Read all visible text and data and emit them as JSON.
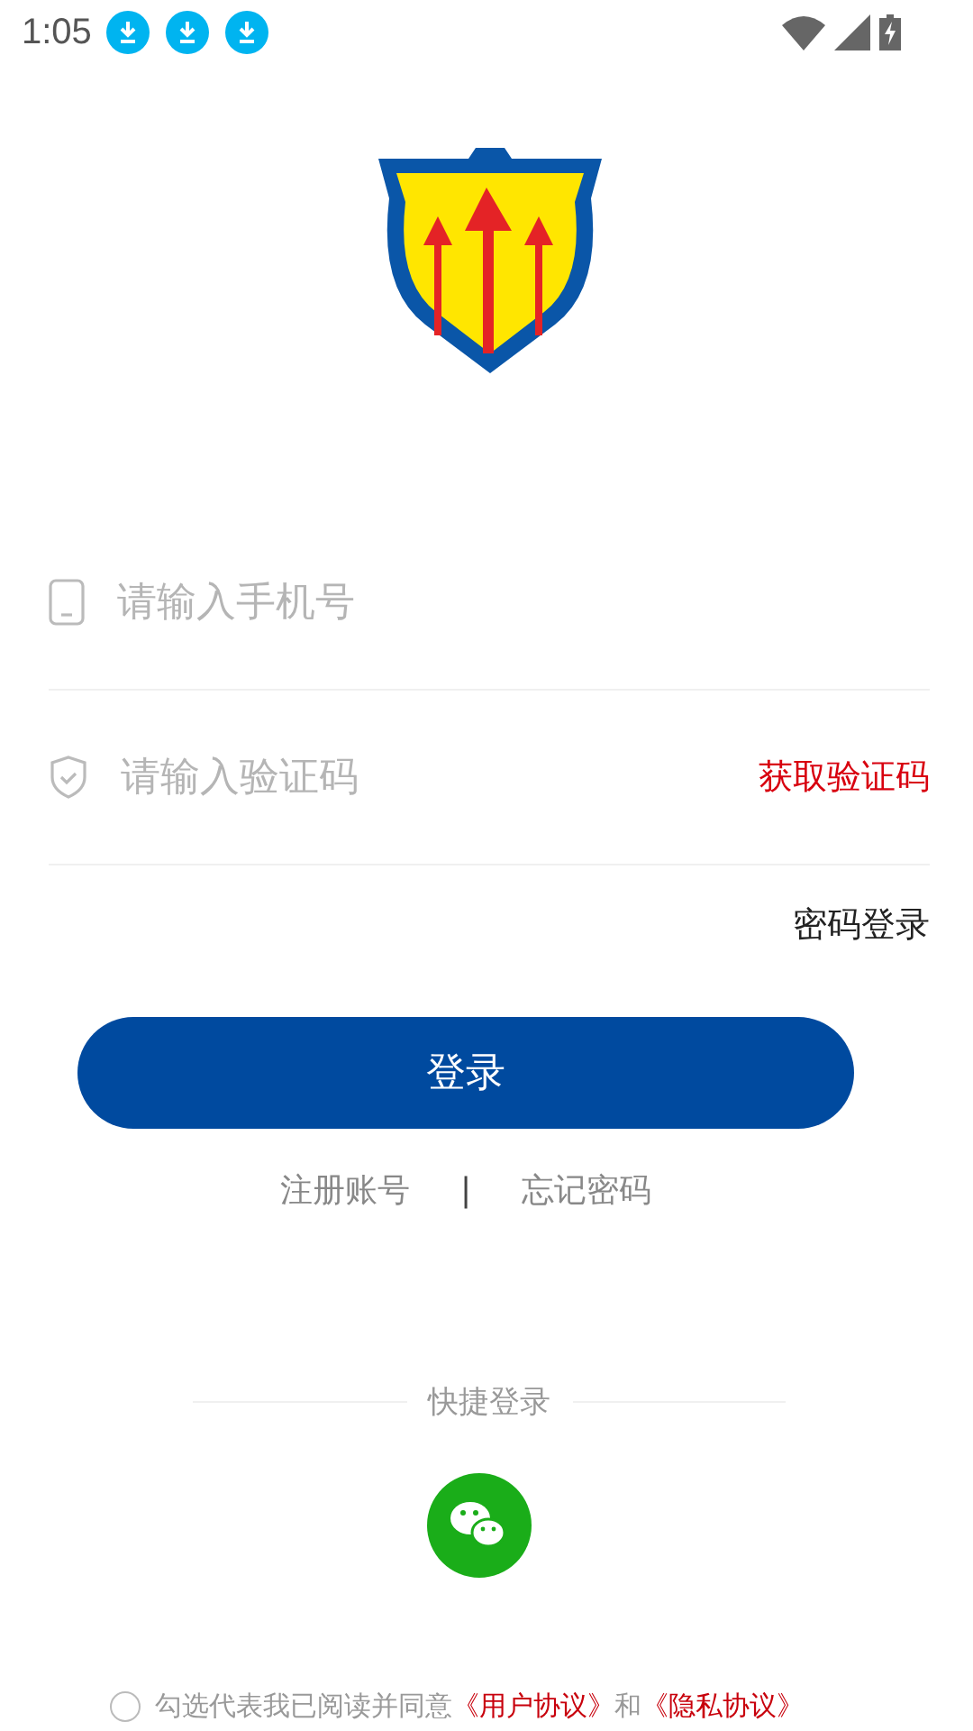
{
  "status_bar": {
    "time": "1:05"
  },
  "phone_field": {
    "placeholder": "请输入手机号"
  },
  "code_field": {
    "placeholder": "请输入验证码",
    "action": "获取验证码"
  },
  "password_login": "密码登录",
  "login_button": "登录",
  "links": [
    {
      "kind": "link",
      "text": "注册账号"
    },
    {
      "kind": "separator",
      "text": "|"
    },
    {
      "kind": "link",
      "text": "忘记密码"
    }
  ],
  "quick_login": {
    "title": "快捷登录"
  },
  "agreement": {
    "checked": false,
    "parts": [
      {
        "kind": "text",
        "text": "勾选代表我已阅读并同意"
      },
      {
        "kind": "link",
        "text": "《用户协议》"
      },
      {
        "kind": "text",
        "text": "和"
      },
      {
        "kind": "link",
        "text": "《隐私协议》"
      }
    ]
  }
}
